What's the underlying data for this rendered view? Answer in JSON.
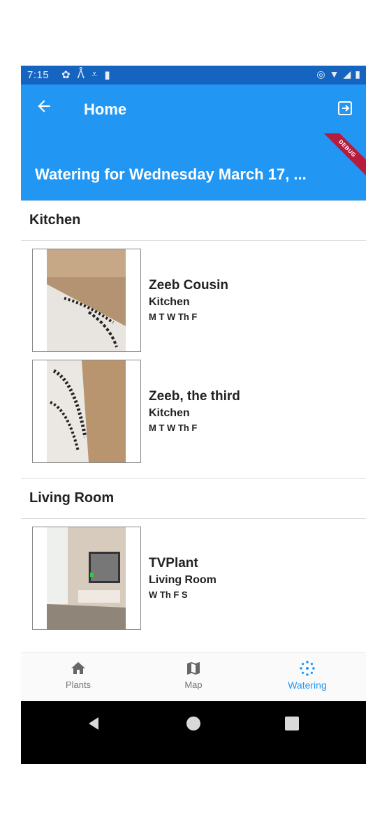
{
  "status_bar": {
    "time": "7:15"
  },
  "app_bar": {
    "title": "Home"
  },
  "header": {
    "subtitle": "Watering for Wednesday March 17, ...",
    "debug_label": "DEBUG"
  },
  "sections": [
    {
      "title": "Kitchen",
      "plants": [
        {
          "name": "Zeeb Cousin",
          "room": "Kitchen",
          "days": "M T W Th F"
        },
        {
          "name": "Zeeb, the third",
          "room": "Kitchen",
          "days": "M T W Th F"
        }
      ]
    },
    {
      "title": "Living Room",
      "plants": [
        {
          "name": "TVPlant",
          "room": "Living Room",
          "days": "W Th F S"
        }
      ]
    }
  ],
  "bottom_nav": {
    "items": [
      {
        "label": "Plants",
        "icon": "home-icon"
      },
      {
        "label": "Map",
        "icon": "map-icon"
      },
      {
        "label": "Watering",
        "icon": "watering-icon",
        "active": true
      }
    ]
  },
  "colors": {
    "primary": "#2196f3",
    "status_bar": "#1565c0",
    "debug": "#b71c3c"
  }
}
